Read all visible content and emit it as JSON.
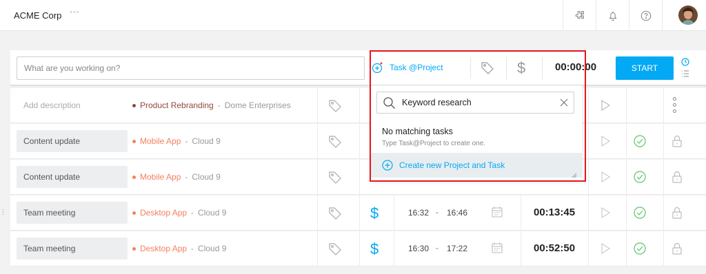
{
  "header": {
    "workspace": "ACME Corp",
    "more_glyph": "◦◦◦",
    "icons": [
      "puzzle-icon",
      "bell-icon",
      "help-icon"
    ]
  },
  "timer": {
    "description_placeholder": "What are you working on?",
    "project_label": "Task @Project",
    "dollar": "$",
    "value": "00:00:00",
    "start_label": "START"
  },
  "dropdown": {
    "search_value": "Keyword research",
    "no_match_title": "No matching tasks",
    "no_match_hint": "Type Task@Project to create one.",
    "create_label": "Create new Project and Task"
  },
  "entries": [
    {
      "description": "Add description",
      "project": "Product Rebranding",
      "client": "Dome Enterprises",
      "project_color": "#8d4b3c"
    },
    {
      "description": "Content update",
      "project": "Mobile App",
      "client": "Cloud 9",
      "project_color": "#f47f5e"
    },
    {
      "description": "Content update",
      "project": "Mobile App",
      "client": "Cloud 9",
      "project_color": "#f47f5e"
    },
    {
      "description": "Team meeting",
      "project": "Desktop App",
      "client": "Cloud 9",
      "project_color": "#f47f5e",
      "billable": "$",
      "start": "16:32",
      "end": "16:46",
      "duration": "00:13:45"
    },
    {
      "description": "Team meeting",
      "project": "Desktop App",
      "client": "Cloud 9",
      "project_color": "#f47f5e",
      "billable": "$",
      "start": "16:30",
      "end": "17:22",
      "duration": "00:52:50"
    }
  ],
  "separators": {
    "dash": "-",
    "time_dash": "-"
  },
  "colors": {
    "accent": "#03a9f4",
    "highlight": "#e8141b",
    "check": "#5cc46a"
  }
}
